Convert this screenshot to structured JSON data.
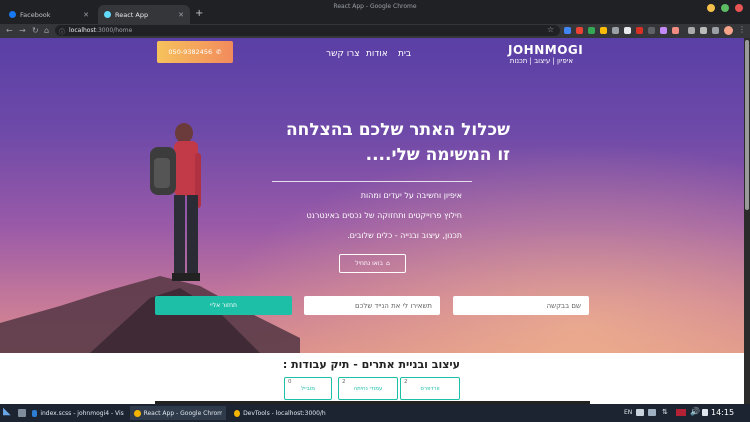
{
  "window": {
    "title": "React App - Google Chrome"
  },
  "tabs": [
    {
      "label": "Facebook",
      "favicon_color": "#1877f2"
    },
    {
      "label": "React App",
      "favicon_color": "#61dafb"
    }
  ],
  "address": {
    "url_host": "localhost",
    "url_path": ":3000/home"
  },
  "site": {
    "brand": "JOHNMOGI",
    "brand_sub": "איפיון | עיצוב | תכנות",
    "nav": {
      "home": "בית",
      "about": "אודות",
      "contact": "צרו קשר"
    },
    "phone": "050-9382456"
  },
  "hero": {
    "headline_line1": "שכלול האתר שלכם בהצלחה",
    "headline_line2": "זו המשימה שלי....",
    "bullets": [
      "איפיון וחשיבה על יעדים ומהות",
      "חילוץ פרוייקטים ותחזוקה של נכסים באינטרנט",
      "תכנון, עיצוב ובנייה - כלים שלובים."
    ],
    "cta_label": "בואו נתחיל"
  },
  "form": {
    "name_placeholder": "שם בבקשה",
    "message_placeholder": "תשאירו לי את הנייד שלכם",
    "submit_label": "תחזור אליי"
  },
  "portfolio": {
    "title": "עיצוב ובניית אתרים - תיק עבודות :",
    "filters": [
      {
        "label": "וורדפרס",
        "count": "2"
      },
      {
        "label": "עמודי נחיתה",
        "count": "2"
      },
      {
        "label": "מובייל",
        "count": "0"
      }
    ]
  },
  "taskbar": {
    "items": [
      {
        "label": "index.scss - johnmogi4 - Visual Stu...",
        "color": "#2d7dd2"
      },
      {
        "label": "React App - Google Chrome",
        "color": "#f4b400"
      },
      {
        "label": "DevTools - localhost:3000/home",
        "color": "#f4b400"
      }
    ],
    "lang": "EN",
    "time": "14:15"
  },
  "colors": {
    "accent": "#1ebfa7",
    "phone_gradient_start": "#f6c25c",
    "phone_gradient_end": "#f28a5c"
  }
}
